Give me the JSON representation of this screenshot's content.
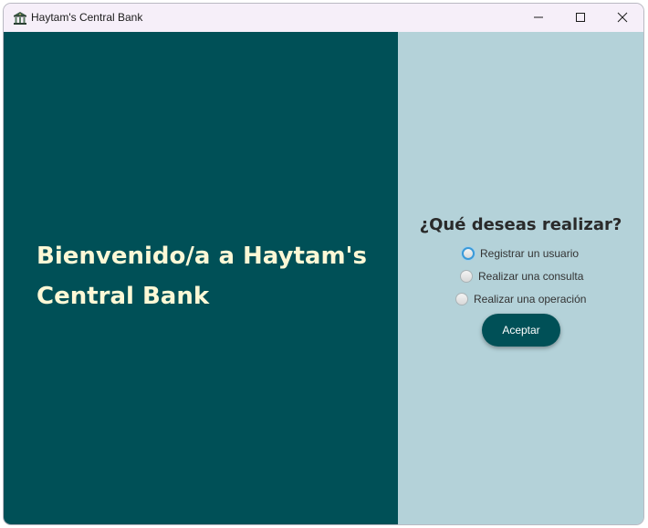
{
  "window": {
    "title": "Haytam's Central Bank",
    "icon": "bank-icon",
    "controls": [
      "minimize-icon",
      "maximize-icon",
      "close-icon"
    ]
  },
  "left_panel": {
    "welcome_line1": "Bienvenido/a a Haytam's",
    "welcome_line2": "Central Bank",
    "background_color": "#005057",
    "text_color": "#fdf8d6"
  },
  "right_panel": {
    "background_color": "#b4d2d9",
    "question": "¿Qué deseas realizar?",
    "options": [
      {
        "label": "Registrar un usuario",
        "selected": false,
        "focused": true
      },
      {
        "label": "Realizar una consulta",
        "selected": false,
        "focused": false
      },
      {
        "label": "Realizar una operación",
        "selected": false,
        "focused": false
      }
    ],
    "accept_label": "Aceptar"
  }
}
